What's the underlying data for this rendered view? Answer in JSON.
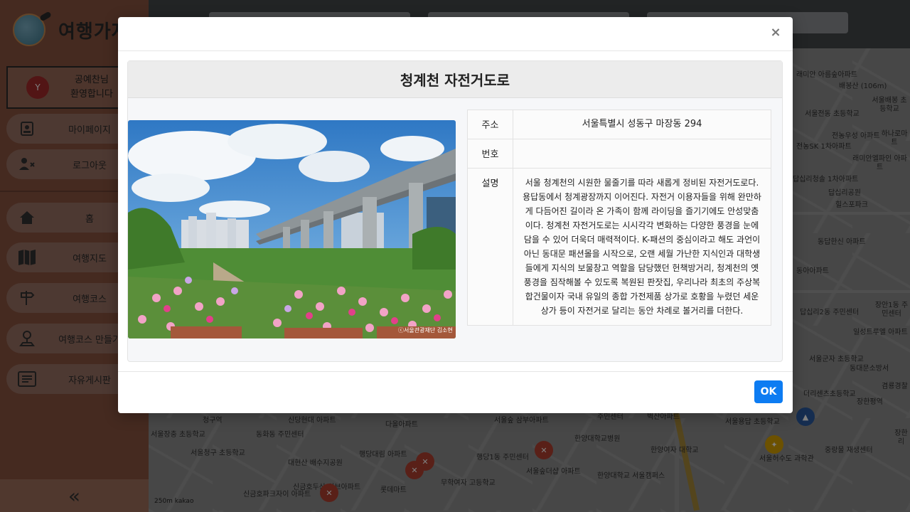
{
  "app": {
    "brand_text": "여행가자"
  },
  "profile": {
    "avatar_initial": "Y",
    "line1": "공예찬님",
    "line2": "환영합니다"
  },
  "sidebar": {
    "top_items": [
      {
        "label": "마이페이지",
        "icon": "id-card-icon"
      },
      {
        "label": "로그아웃",
        "icon": "user-x-icon"
      }
    ],
    "nav_items": [
      {
        "label": "홈",
        "icon": "home-icon"
      },
      {
        "label": "여행지도",
        "icon": "map-icon"
      },
      {
        "label": "여행코스",
        "icon": "signpost-icon"
      },
      {
        "label": "여행코스 만들기",
        "icon": "pin-user-icon"
      },
      {
        "label": "자유게시판",
        "icon": "board-icon"
      }
    ],
    "collapse_glyph": "«"
  },
  "map": {
    "labels": [
      "래미안 아름숲아파트",
      "배봉산 (106m)",
      "서울배봉 초등학교",
      "서울전동 초등학교",
      "전농우성 아파트",
      "하나로마트",
      "전농SK 1차아파트",
      "래미안엘파인 아파트",
      "답십리청솔 1차아파트",
      "답십리공원",
      "힐스포파크",
      "동답한신 아파트",
      "동아아파트",
      "답십리2동 주민센터",
      "장안1동 주민센터",
      "일성트루엘 아파트",
      "서울군자 초등학교",
      "동대문소방서",
      "더리센츠초등학교",
      "겸룡경찰",
      "청구역",
      "신당현대 아파트",
      "다올아파트",
      "서울숲 삼부아파트",
      "주민센터",
      "벽산아파트",
      "서울용답 초등학교",
      "서울장충 초등학교",
      "동화동 주민센터",
      "서울청구 초등학교",
      "행당대림 아파트",
      "행당1동 주민센터",
      "한양대학교병원",
      "한양여자 대학교",
      "서울허수도 과학관",
      "중랑물 재생센터",
      "대현산 배수지공원",
      "무학여자 고등학교",
      "서울숲더샵 아파트",
      "롯데마트",
      "한양대학교 서울캠퍼스",
      "신금호파크자이 아파트",
      "신금호두산 위브아파트",
      "장한평역",
      "장한 리"
    ],
    "scale_text": "250m kakao"
  },
  "modal": {
    "title": "청계천 자전거도로",
    "close_glyph": "×",
    "rows": [
      {
        "key": "주소",
        "value": "서울특별시 성동구 마장동 294"
      },
      {
        "key": "번호",
        "value": ""
      },
      {
        "key": "설명",
        "value": "서울 청계천의 시원한 물줄기를 따라 새롭게 정비된 자전거도로다. 용답동에서 청계광장까지 이어진다. 자전거 이용자들을 위해 완만하게 다듬어진 길이라 온 가족이 함께 라이딩을 즐기기에도 안성맞춤이다. 청계천 자전거도로는 시시각각 변화하는 다양한 풍경을 눈에 담을 수 있어 더욱더 매력적이다. K-패션의 중심이라고 해도 과언이 아닌 동대문 패션몰을 시작으로, 오랜 세월 가난한 지식인과 대학생들에게 지식의 보물창고 역할을 담당했던 헌책방거리, 청계천의 옛 풍경을 짐작해볼 수 있도록 복원된 판잣집, 우리나라 최초의 주상복합건물이자 국내 유일의 종합 가전제품 상가로 호황을 누렸던 세운상가 등이 자전거로 달리는 동안 차례로 볼거리를 더한다."
      }
    ],
    "photo_caption": "ⓒ서울관광재단 김소현",
    "ok_label": "OK"
  }
}
